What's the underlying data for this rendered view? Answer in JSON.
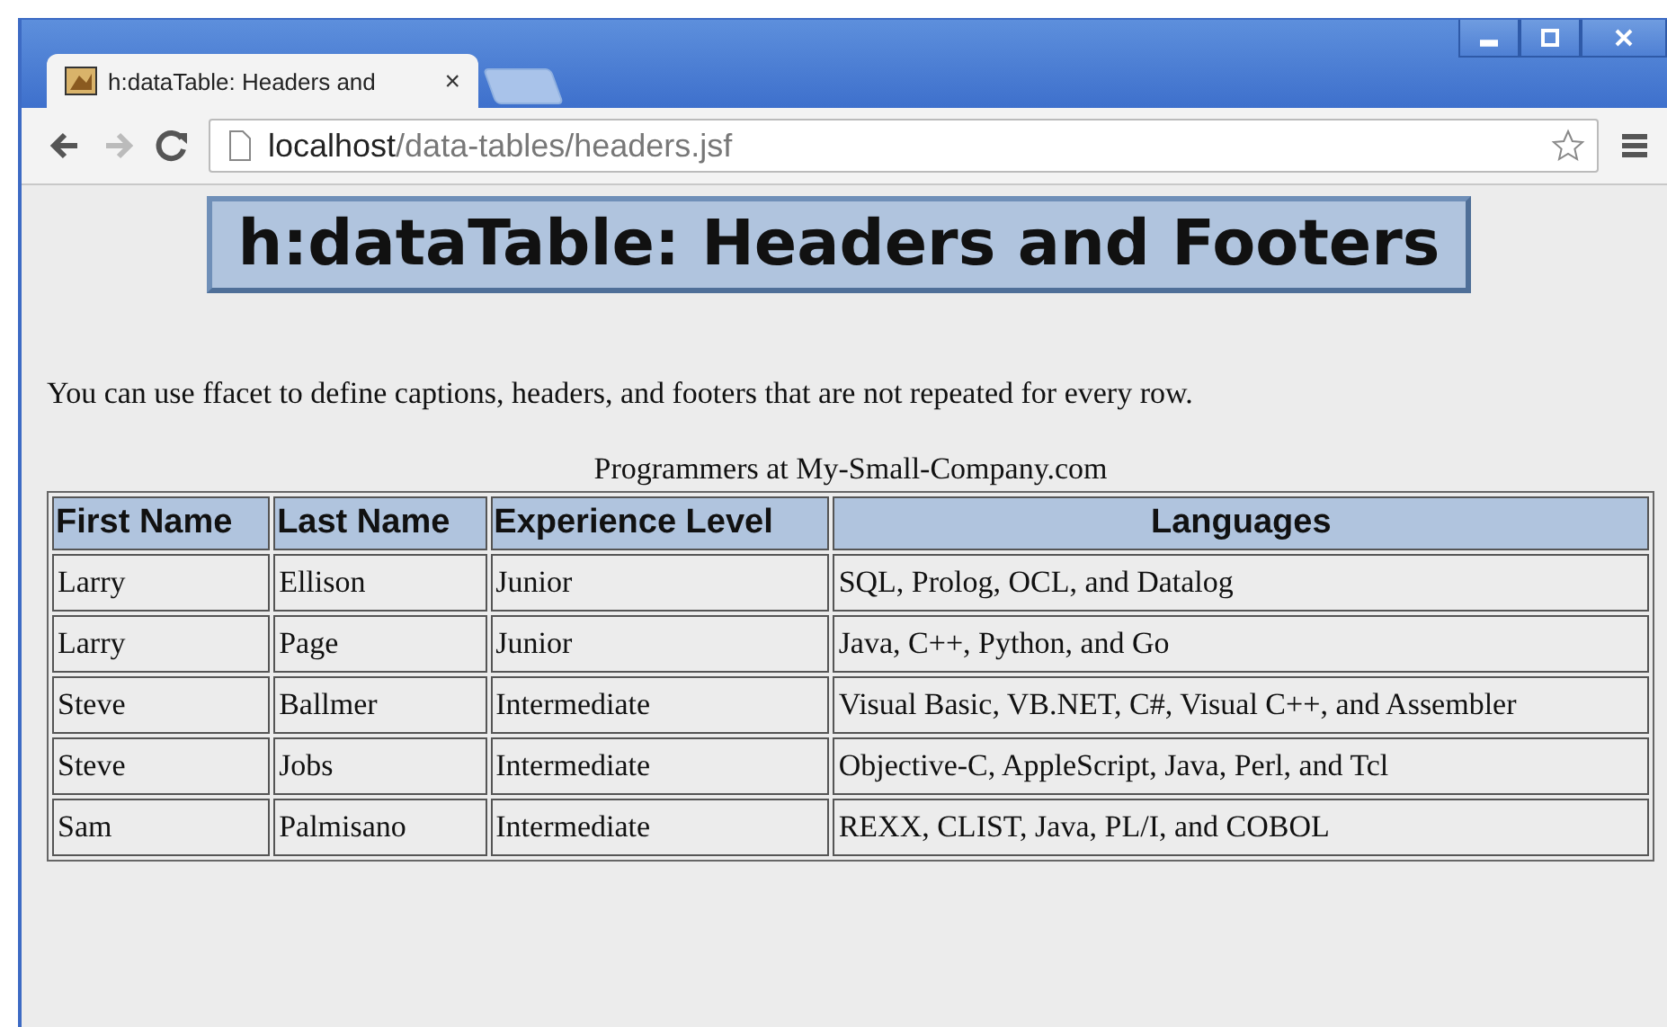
{
  "browser": {
    "tabs": [
      {
        "title": "h:dataTable: Headers and",
        "close": "×",
        "selected": true
      }
    ],
    "address": {
      "host": "localhost",
      "path": "/data-tables/headers.jsf"
    }
  },
  "page": {
    "heading": "h:dataTable: Headers and Footers",
    "intro": "You can use ffacet to define captions, headers, and footers that are not repeated for every row.",
    "table": {
      "caption": "Programmers at My-Small-Company.com",
      "columns": [
        "First Name",
        "Last Name",
        "Experience Level",
        "Languages"
      ],
      "rows": [
        [
          "Larry",
          "Ellison",
          "Junior",
          "SQL, Prolog, OCL, and Datalog"
        ],
        [
          "Larry",
          "Page",
          "Junior",
          "Java, C++, Python, and Go"
        ],
        [
          "Steve",
          "Ballmer",
          "Intermediate",
          "Visual Basic, VB.NET, C#, Visual C++, and Assembler"
        ],
        [
          "Steve",
          "Jobs",
          "Intermediate",
          "Objective-C, AppleScript, Java, Perl, and Tcl"
        ],
        [
          "Sam",
          "Palmisano",
          "Intermediate",
          "REXX, CLIST, Java, PL/I, and COBOL"
        ]
      ]
    }
  }
}
